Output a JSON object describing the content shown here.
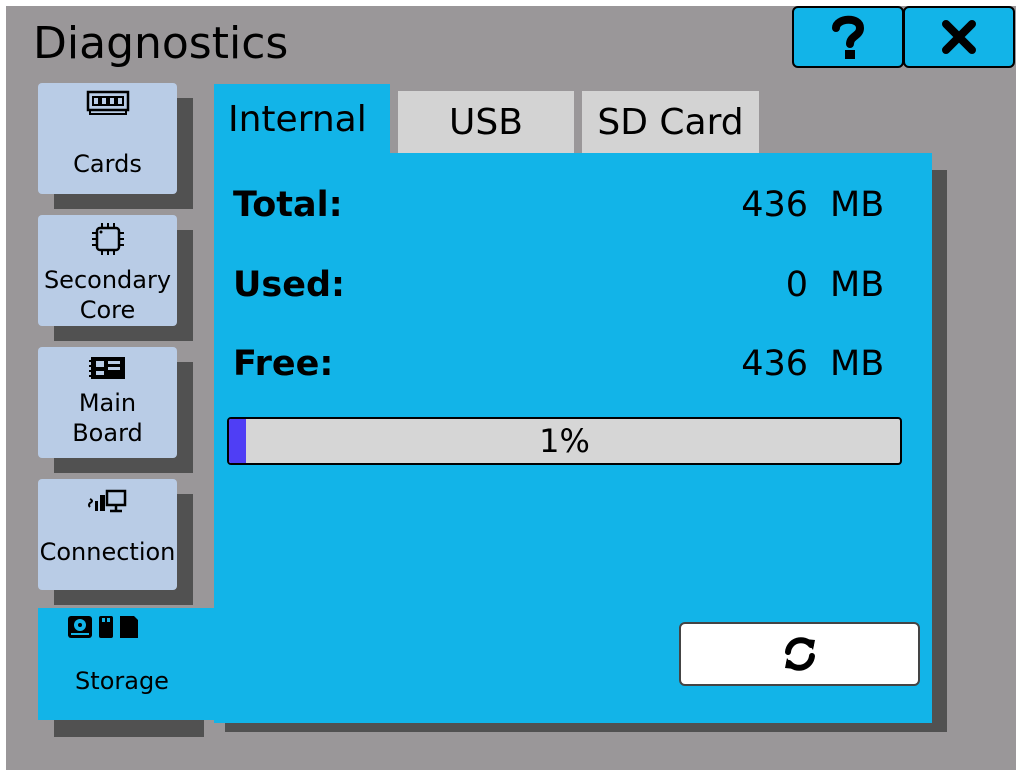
{
  "header": {
    "title": "Diagnostics",
    "help_icon": "question-mark-icon",
    "close_icon": "close-x-icon"
  },
  "sidebar": {
    "items": [
      {
        "label": "Cards",
        "icon": "memory-card-icon"
      },
      {
        "label": "Secondary",
        "label2": "Core",
        "icon": "chip-icon"
      },
      {
        "label": "Main",
        "label2": "Board",
        "icon": "circuit-board-icon"
      },
      {
        "label": "Connection",
        "icon": "network-connection-icon"
      },
      {
        "label": "Storage",
        "icon": "storage-devices-icon",
        "active": true
      }
    ]
  },
  "tabs": [
    {
      "label": "Internal",
      "active": true
    },
    {
      "label": "USB",
      "active": false
    },
    {
      "label": "SD Card",
      "active": false
    }
  ],
  "storage": {
    "total_label": "Total:",
    "total_value": "436",
    "total_unit": "MB",
    "used_label": "Used:",
    "used_value": "0",
    "used_unit": "MB",
    "free_label": "Free:",
    "free_value": "436",
    "free_unit": "MB",
    "usage_percent": 1,
    "usage_text": "1%"
  },
  "refresh_icon": "refresh-icon",
  "colors": {
    "background": "#9a9799",
    "accent": "#12b4e8",
    "nav_button": "#b9cce6",
    "progress_fill": "#4f3ef5"
  }
}
